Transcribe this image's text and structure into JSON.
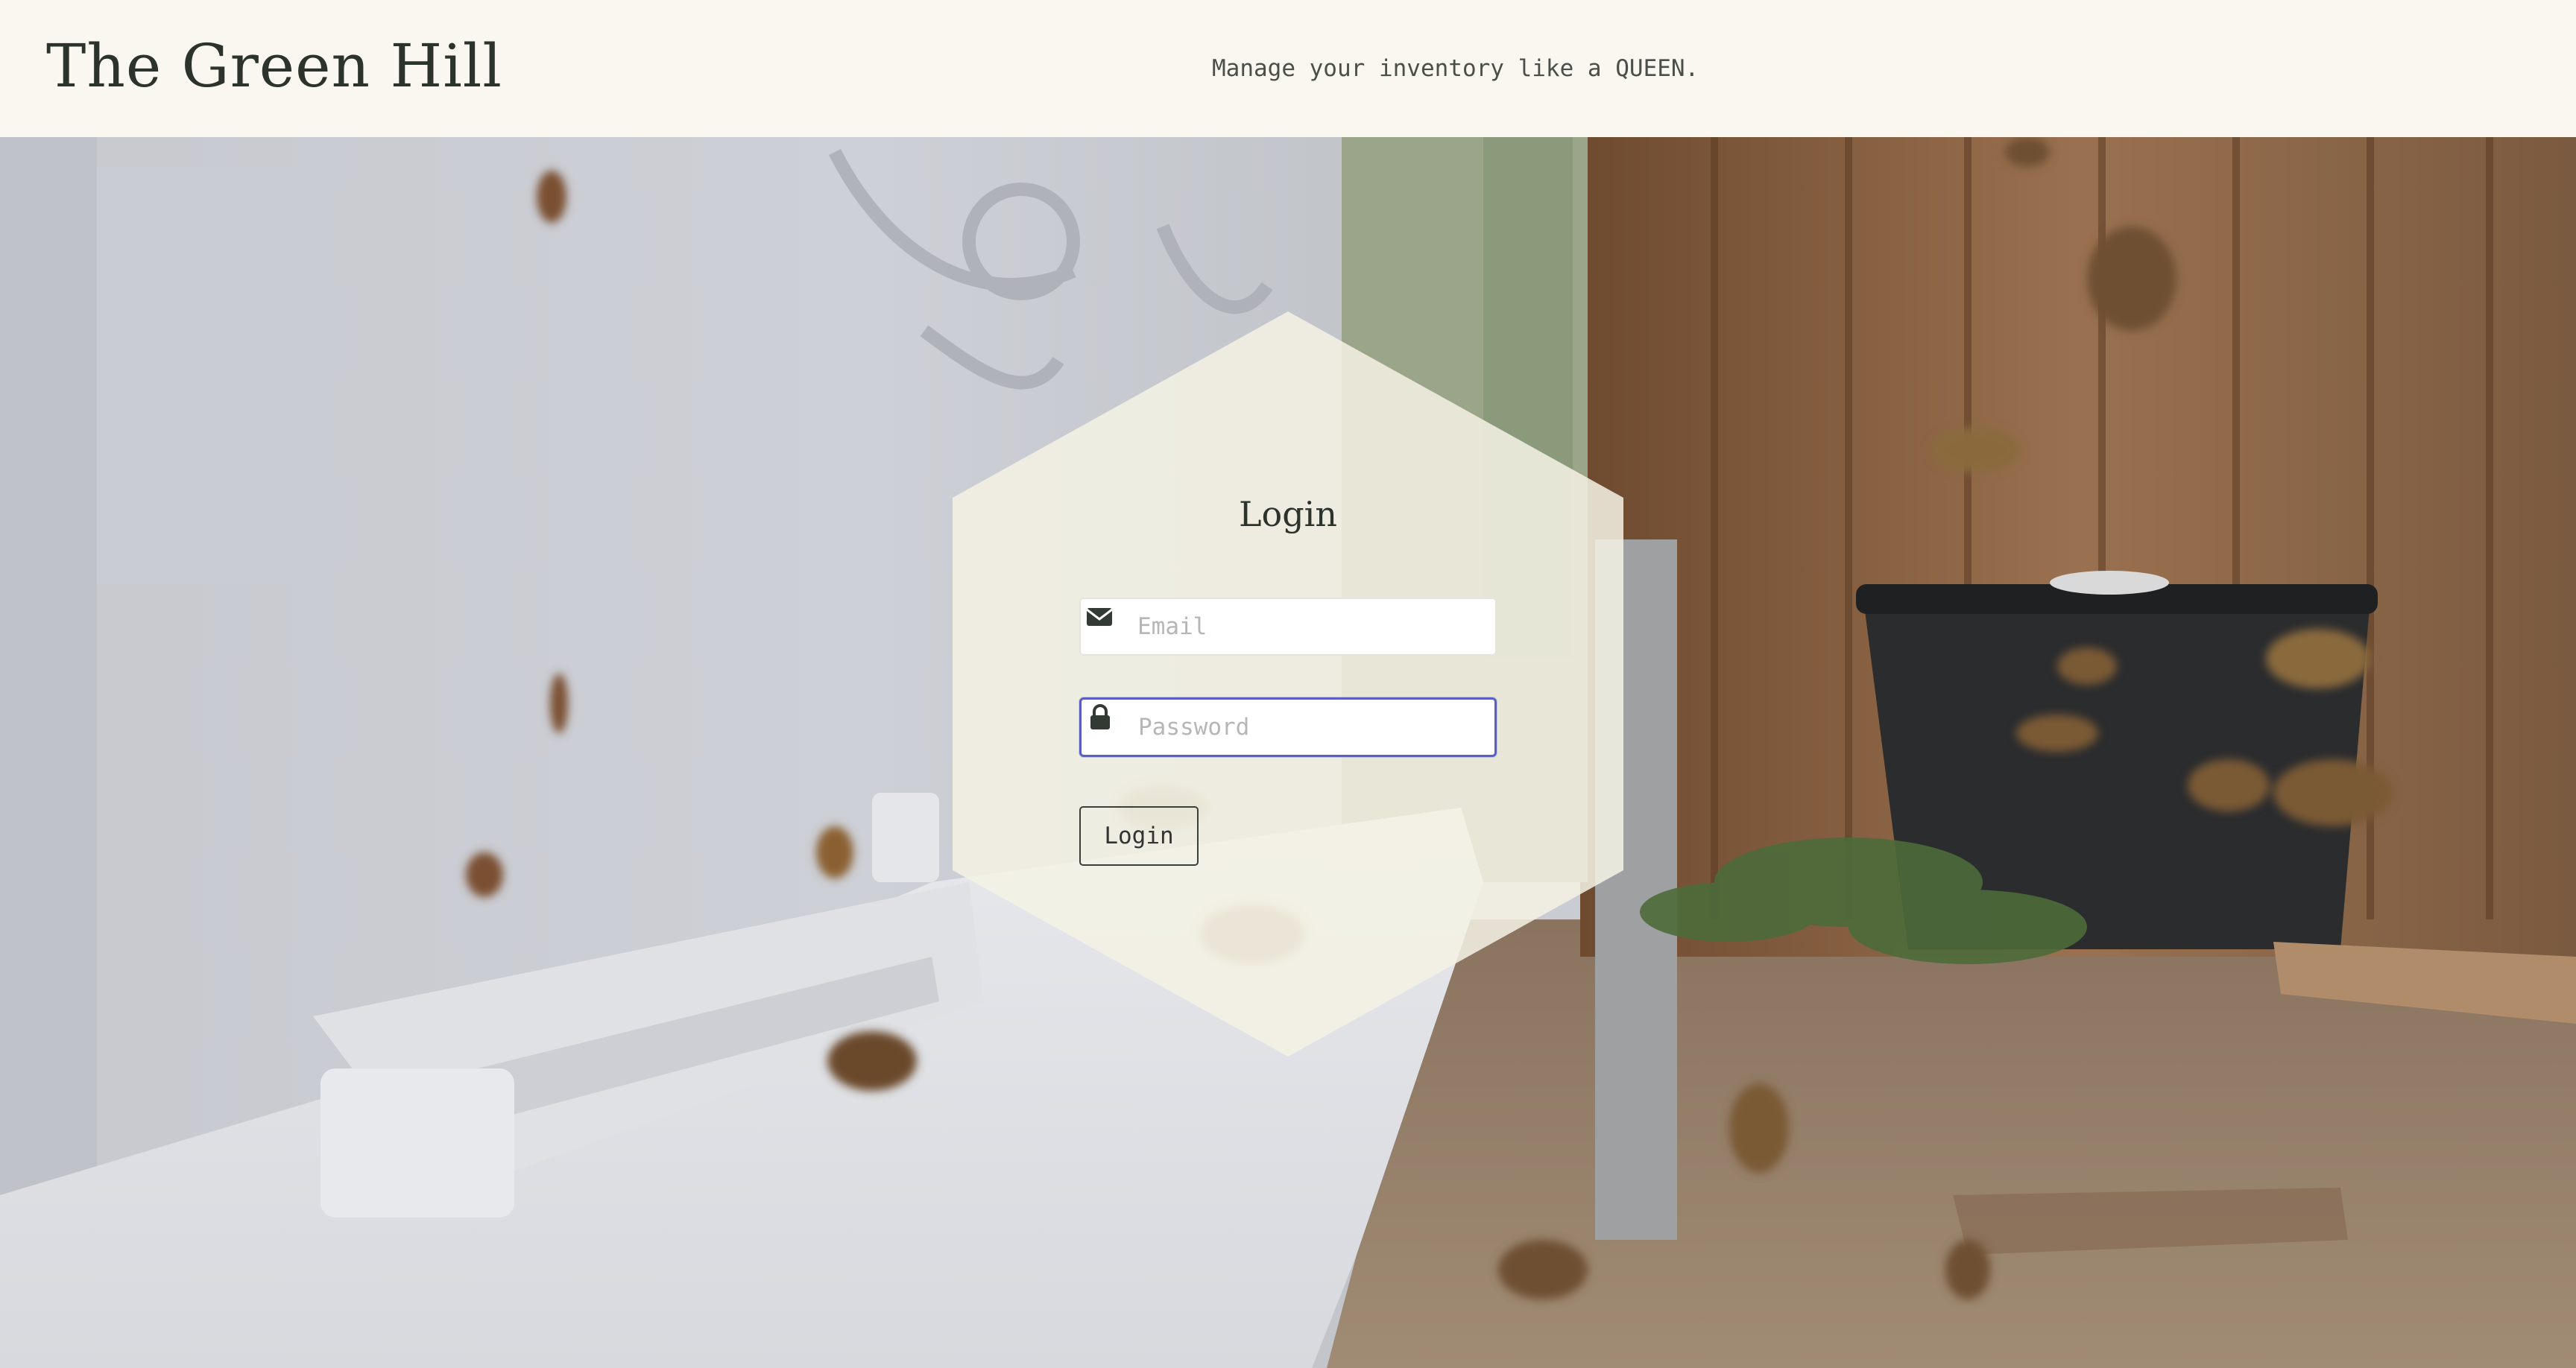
{
  "header": {
    "site_title": "The Green Hill",
    "tagline": "Manage your inventory like a QUEEN."
  },
  "login": {
    "title": "Login",
    "email": {
      "placeholder": "Email",
      "value": "",
      "icon": "envelope-icon"
    },
    "password": {
      "placeholder": "Password",
      "value": "",
      "icon": "lock-icon",
      "focused": true
    },
    "submit_label": "Login"
  },
  "colors": {
    "header_bg": "#faf7f0",
    "text_dark": "#2b332c",
    "panel_bg": "#f5f2e4",
    "focus_ring": "#5a5fc8"
  }
}
